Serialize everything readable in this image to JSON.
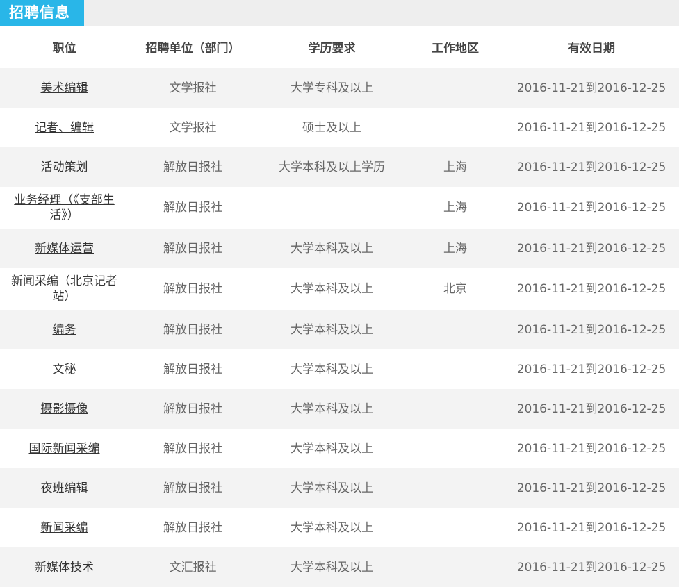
{
  "header_title": "招聘信息",
  "columns": [
    "职位",
    "招聘单位（部门）",
    "学历要求",
    "工作地区",
    "有效日期"
  ],
  "rows": [
    {
      "position": "美术编辑",
      "unit": "文学报社",
      "education": "大学专科及以上",
      "region": "",
      "date": "2016-11-21到2016-12-25"
    },
    {
      "position": "记者、编辑",
      "unit": "文学报社",
      "education": "硕士及以上",
      "region": "",
      "date": "2016-11-21到2016-12-25"
    },
    {
      "position": "活动策划",
      "unit": "解放日报社",
      "education": "大学本科及以上学历",
      "region": "上海",
      "date": "2016-11-21到2016-12-25"
    },
    {
      "position": "业务经理（《支部生活》）",
      "unit": "解放日报社",
      "education": "",
      "region": "上海",
      "date": "2016-11-21到2016-12-25"
    },
    {
      "position": "新媒体运营",
      "unit": "解放日报社",
      "education": "大学本科及以上",
      "region": "上海",
      "date": "2016-11-21到2016-12-25"
    },
    {
      "position": "新闻采编（北京记者站）",
      "unit": "解放日报社",
      "education": "大学本科及以上",
      "region": "北京",
      "date": "2016-11-21到2016-12-25"
    },
    {
      "position": "编务",
      "unit": "解放日报社",
      "education": "大学本科及以上",
      "region": "",
      "date": "2016-11-21到2016-12-25"
    },
    {
      "position": "文秘",
      "unit": "解放日报社",
      "education": "大学本科及以上",
      "region": "",
      "date": "2016-11-21到2016-12-25"
    },
    {
      "position": "摄影摄像",
      "unit": "解放日报社",
      "education": "大学本科及以上",
      "region": "",
      "date": "2016-11-21到2016-12-25"
    },
    {
      "position": "国际新闻采编",
      "unit": "解放日报社",
      "education": "大学本科及以上",
      "region": "",
      "date": "2016-11-21到2016-12-25"
    },
    {
      "position": "夜班编辑",
      "unit": "解放日报社",
      "education": "大学本科及以上",
      "region": "",
      "date": "2016-11-21到2016-12-25"
    },
    {
      "position": "新闻采编",
      "unit": "解放日报社",
      "education": "大学本科及以上",
      "region": "",
      "date": "2016-11-21到2016-12-25"
    },
    {
      "position": "新媒体技术",
      "unit": "文汇报社",
      "education": "大学本科及以上",
      "region": "",
      "date": "2016-11-21到2016-12-25"
    }
  ]
}
